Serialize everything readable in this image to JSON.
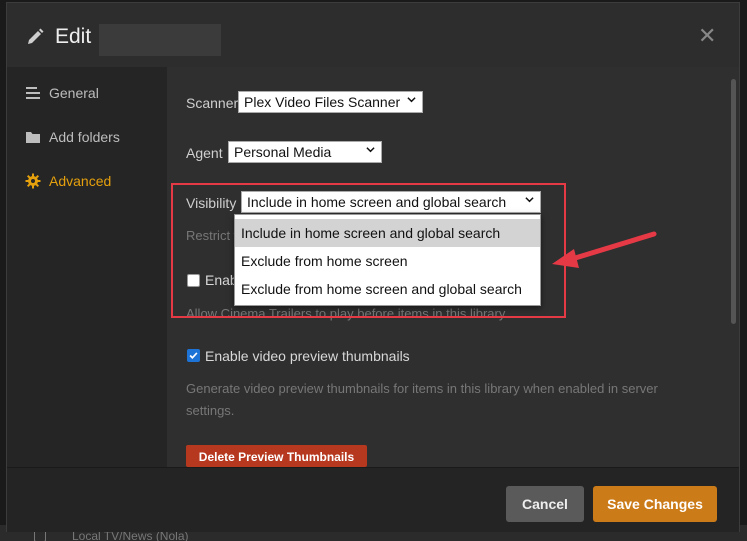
{
  "header": {
    "title": "Edit"
  },
  "sidebar": {
    "items": [
      {
        "label": "General",
        "icon": "list-icon"
      },
      {
        "label": "Add folders",
        "icon": "folder-icon"
      },
      {
        "label": "Advanced",
        "icon": "gear-icon",
        "active": true
      }
    ]
  },
  "form": {
    "scanner": {
      "label": "Scanner",
      "value": "Plex Video Files Scanner"
    },
    "agent": {
      "label": "Agent",
      "value": "Personal Media"
    },
    "visibility": {
      "label": "Visibility",
      "value": "Include in home screen and global search",
      "helper": "Restrict w",
      "options": [
        "Include in home screen and global search",
        "Exclude from home screen",
        "Exclude from home screen and global search"
      ]
    },
    "cinema_trailers": {
      "label": "Enable",
      "checked": false,
      "helper": "Allow Cinema Trailers to play before items in this library."
    },
    "video_preview": {
      "label": "Enable video preview thumbnails",
      "checked": true,
      "helper_line1": "Generate video preview thumbnails for items in this library when enabled in server",
      "helper_line2": "settings."
    },
    "delete_button": "Delete Preview Thumbnails"
  },
  "footer": {
    "cancel": "Cancel",
    "save": "Save Changes"
  },
  "background": {
    "peek_text": "Local TV/News (Nola)"
  },
  "colors": {
    "accent": "#e5a00d",
    "save_button": "#cc7b19",
    "delete_button": "#b5381f",
    "annotation": "#e63946",
    "checkbox_checked": "#1d73d6"
  }
}
